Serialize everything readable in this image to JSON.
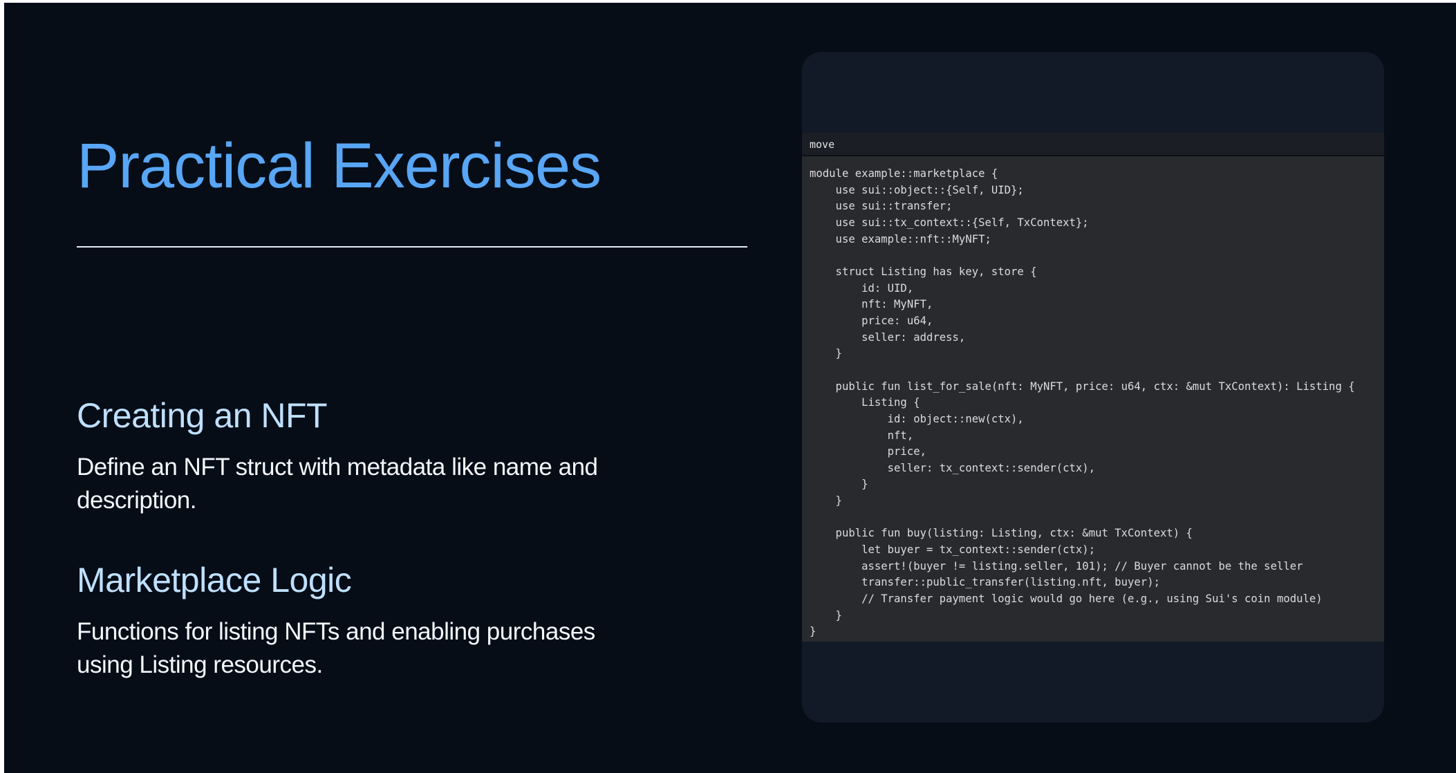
{
  "slide": {
    "title": "Practical Exercises",
    "sections": [
      {
        "heading": "Creating an NFT",
        "body": "Define an NFT struct with metadata like name and description."
      },
      {
        "heading": "Marketplace Logic",
        "body": "Functions for listing NFTs and enabling purchases using Listing resources."
      }
    ]
  },
  "code_block": {
    "language": "move",
    "code": "module example::marketplace {\n    use sui::object::{Self, UID};\n    use sui::transfer;\n    use sui::tx_context::{Self, TxContext};\n    use example::nft::MyNFT;\n\n    struct Listing has key, store {\n        id: UID,\n        nft: MyNFT,\n        price: u64,\n        seller: address,\n    }\n\n    public fun list_for_sale(nft: MyNFT, price: u64, ctx: &mut TxContext): Listing {\n        Listing {\n            id: object::new(ctx),\n            nft,\n            price,\n            seller: tx_context::sender(ctx),\n        }\n    }\n\n    public fun buy(listing: Listing, ctx: &mut TxContext) {\n        let buyer = tx_context::sender(ctx);\n        assert!(buyer != listing.seller, 101); // Buyer cannot be the seller\n        transfer::public_transfer(listing.nft, buyer);\n        // Transfer payment logic would go here (e.g., using Sui's coin module)\n    }\n}"
  },
  "colors": {
    "background": "#060d17",
    "title": "#58a6f5",
    "section_heading": "#bfe0ff",
    "body_text": "#f4f7fb",
    "code_card": "#111a26",
    "code_background": "#282a2e"
  }
}
